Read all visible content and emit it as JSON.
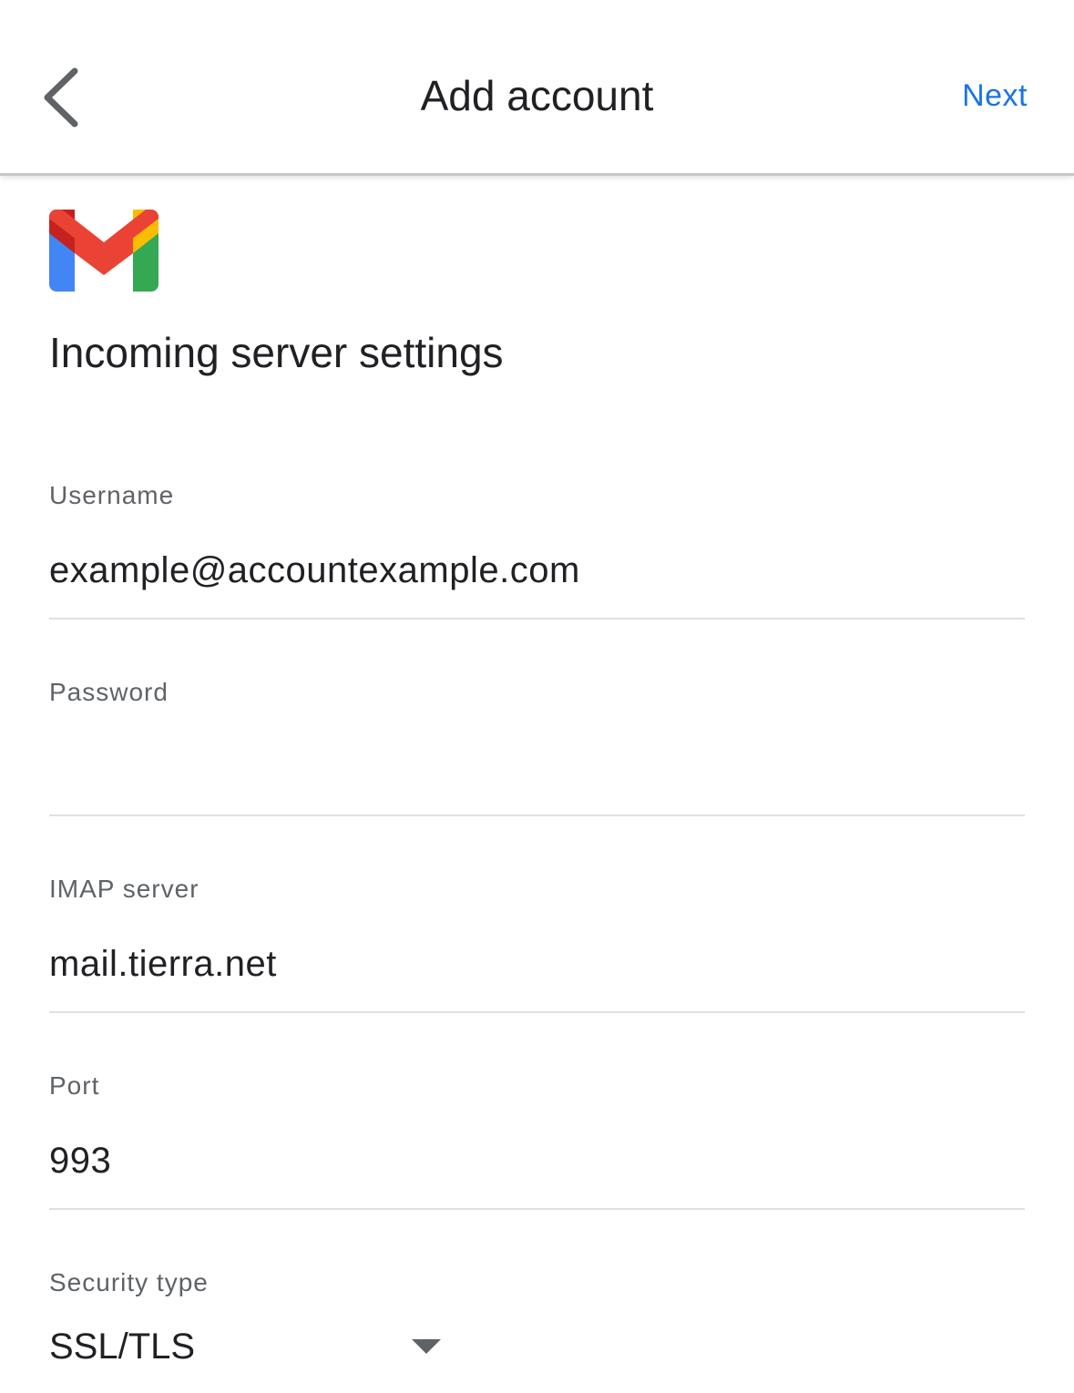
{
  "header": {
    "title": "Add account",
    "next_label": "Next"
  },
  "section": {
    "title": "Incoming server settings"
  },
  "fields": {
    "username": {
      "label": "Username",
      "value": "example@accountexample.com"
    },
    "password": {
      "label": "Password",
      "value": ""
    },
    "imap_server": {
      "label": "IMAP server",
      "value": "mail.tierra.net"
    },
    "port": {
      "label": "Port",
      "value": "993"
    },
    "security_type": {
      "label": "Security type",
      "value": "SSL/TLS"
    }
  },
  "icons": {
    "back": "chevron-left-icon",
    "logo": "gmail-logo",
    "dropdown": "caret-down-icon"
  },
  "colors": {
    "accent": "#1a73e8",
    "text_primary": "#202124",
    "text_secondary": "#5f6368",
    "divider": "#e0e0e0"
  }
}
